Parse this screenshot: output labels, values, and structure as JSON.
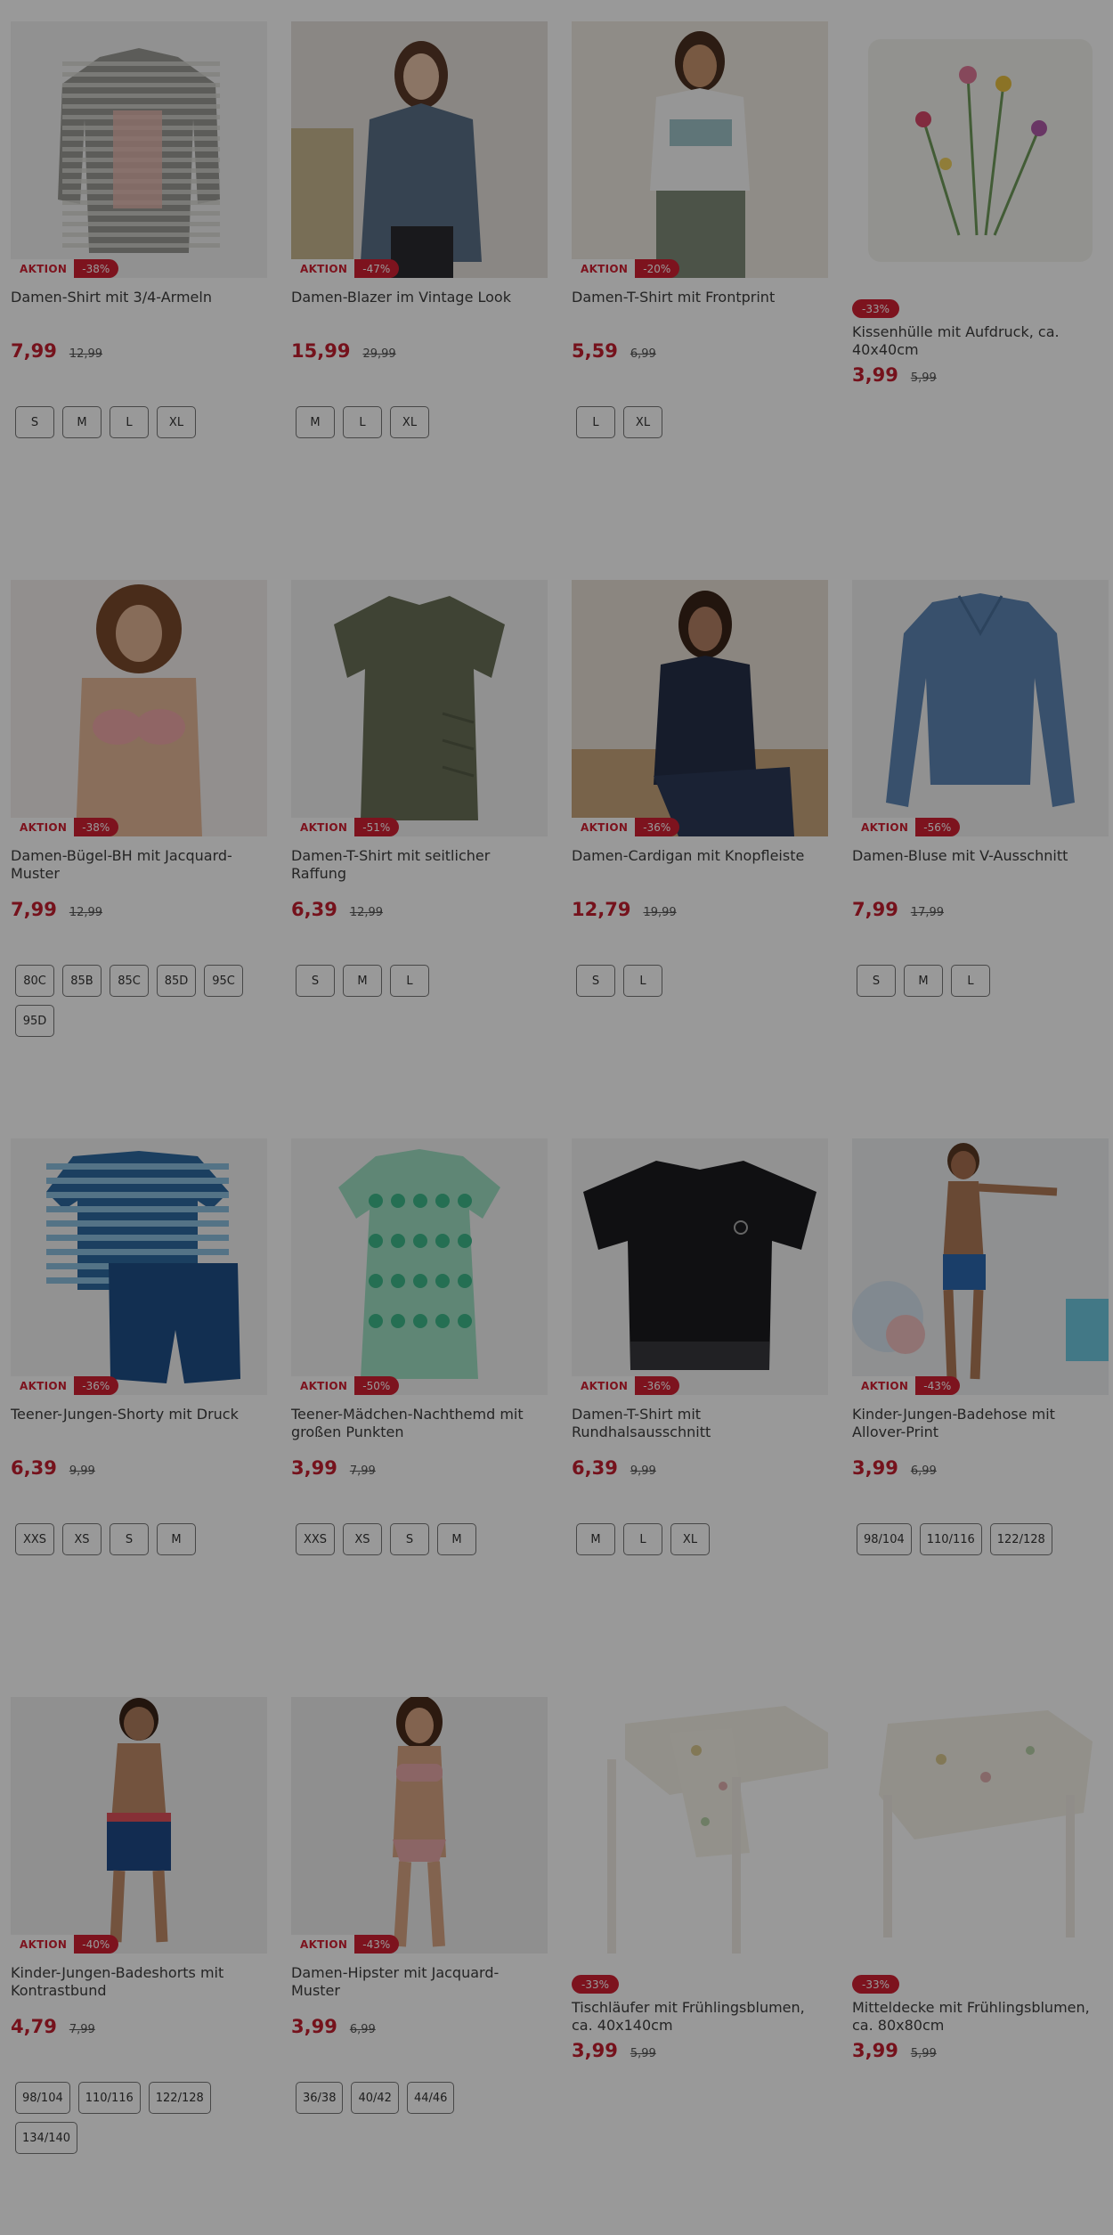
{
  "products": [
    {
      "title": "Damen-Shirt mit 3/4-Armeln",
      "aktion": "AKTION",
      "discount": "-38%",
      "price": "7,99",
      "old_price": "12,99",
      "sizes": [
        "S",
        "M",
        "L",
        "XL"
      ],
      "image": "striped-shirt"
    },
    {
      "title": "Damen-Blazer im Vintage Look",
      "aktion": "AKTION",
      "discount": "-47%",
      "price": "15,99",
      "old_price": "29,99",
      "sizes": [
        "M",
        "L",
        "XL"
      ],
      "image": "denim-blazer-model"
    },
    {
      "title": "Damen-T-Shirt mit Frontprint",
      "aktion": "AKTION",
      "discount": "-20%",
      "price": "5,59",
      "old_price": "6,99",
      "sizes": [
        "L",
        "XL"
      ],
      "image": "white-tshirt-model"
    },
    {
      "title": "Kissenhülle mit Aufdruck, ca. 40x40cm",
      "aktion": "",
      "discount": "-33%",
      "price": "3,99",
      "old_price": "5,99",
      "sizes": [],
      "image": "floral-cushion"
    },
    {
      "title": "Damen-Bügel-BH mit Jacquard-Muster",
      "aktion": "AKTION",
      "discount": "-38%",
      "price": "7,99",
      "old_price": "12,99",
      "sizes": [
        "80C",
        "85B",
        "85C",
        "85D",
        "95C",
        "95D"
      ],
      "image": "bra-model"
    },
    {
      "title": "Damen-T-Shirt mit seitlicher Raffung",
      "aktion": "AKTION",
      "discount": "-51%",
      "price": "6,39",
      "old_price": "12,99",
      "sizes": [
        "S",
        "M",
        "L"
      ],
      "image": "olive-tshirt"
    },
    {
      "title": "Damen-Cardigan mit Knopfleiste",
      "aktion": "AKTION",
      "discount": "-36%",
      "price": "12,79",
      "old_price": "19,99",
      "sizes": [
        "S",
        "L"
      ],
      "image": "navy-cardigan-model"
    },
    {
      "title": "Damen-Bluse mit V-Ausschnitt",
      "aktion": "AKTION",
      "discount": "-56%",
      "price": "7,99",
      "old_price": "17,99",
      "sizes": [
        "S",
        "M",
        "L"
      ],
      "image": "blue-blouse"
    },
    {
      "title": "Teener-Jungen-Shorty mit Druck",
      "aktion": "AKTION",
      "discount": "-36%",
      "price": "6,39",
      "old_price": "9,99",
      "sizes": [
        "XXS",
        "XS",
        "S",
        "M"
      ],
      "image": "striped-shorty"
    },
    {
      "title": "Teener-Mädchen-Nachthemd mit großen Punkten",
      "aktion": "AKTION",
      "discount": "-50%",
      "price": "3,99",
      "old_price": "7,99",
      "sizes": [
        "XXS",
        "XS",
        "S",
        "M"
      ],
      "image": "mint-nightdress"
    },
    {
      "title": "Damen-T-Shirt mit Rundhalsausschnitt",
      "aktion": "AKTION",
      "discount": "-36%",
      "price": "6,39",
      "old_price": "9,99",
      "sizes": [
        "M",
        "L",
        "XL"
      ],
      "image": "black-tshirt"
    },
    {
      "title": "Kinder-Jungen-Badehose mit Allover-Print",
      "aktion": "AKTION",
      "discount": "-43%",
      "price": "3,99",
      "old_price": "6,99",
      "sizes": [
        "98/104",
        "110/116",
        "122/128"
      ],
      "image": "boy-swim-trunks"
    },
    {
      "title": "Kinder-Jungen-Badeshorts mit Kontrastbund",
      "aktion": "AKTION",
      "discount": "-40%",
      "price": "4,79",
      "old_price": "7,99",
      "sizes": [
        "98/104",
        "110/116",
        "122/128",
        "134/140"
      ],
      "image": "boy-swim-shorts"
    },
    {
      "title": "Damen-Hipster mit Jacquard-Muster",
      "aktion": "AKTION",
      "discount": "-43%",
      "price": "3,99",
      "old_price": "6,99",
      "sizes": [
        "36/38",
        "40/42",
        "44/46"
      ],
      "image": "hipster-model"
    },
    {
      "title": "Tischläufer mit Frühlingsblumen, ca. 40x140cm",
      "aktion": "",
      "discount": "-33%",
      "price": "3,99",
      "old_price": "5,99",
      "sizes": [],
      "image": "table-runner"
    },
    {
      "title": "Mitteldecke mit Frühlingsblumen, ca. 80x80cm",
      "aktion": "",
      "discount": "-33%",
      "price": "3,99",
      "old_price": "5,99",
      "sizes": [],
      "image": "table-cloth"
    }
  ]
}
